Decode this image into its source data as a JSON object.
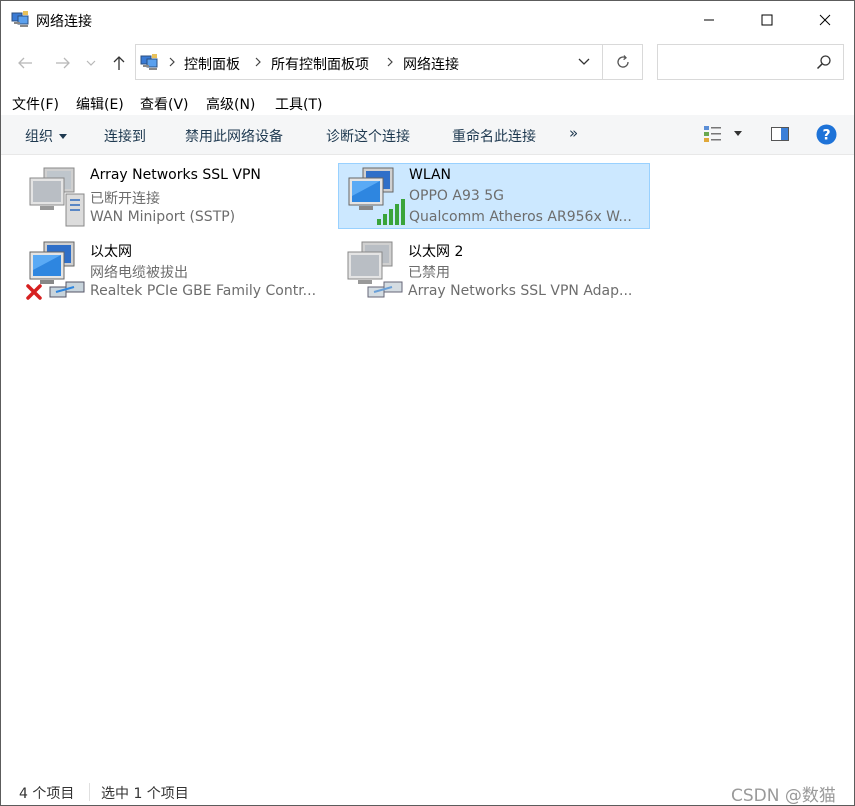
{
  "window": {
    "title": "网络连接",
    "minimize_glyph": "—",
    "maximize_glyph": "☐",
    "close_glyph": "✕"
  },
  "address": {
    "crumbs": [
      "控制面板",
      "所有控制面板项",
      "网络连接"
    ]
  },
  "search": {
    "placeholder": "",
    "value": ""
  },
  "menu": [
    "文件(F)",
    "编辑(E)",
    "查看(V)",
    "高级(N)",
    "工具(T)"
  ],
  "toolbar": {
    "organize": "组织",
    "connect_to": "连接到",
    "disable_device": "禁用此网络设备",
    "diagnose": "诊断这个连接",
    "rename": "重命名此连接",
    "more": "»"
  },
  "connections": [
    {
      "name": "Array Networks SSL VPN",
      "status": "已断开连接",
      "device": "WAN Miniport (SSTP)",
      "type": "vpn",
      "selected": false
    },
    {
      "name": "WLAN",
      "status": "OPPO A93 5G",
      "device": "Qualcomm Atheros AR956x W...",
      "type": "wifi",
      "selected": true
    },
    {
      "name": "以太网",
      "status": "网络电缆被拔出",
      "device": "Realtek PCIe GBE Family Contr...",
      "type": "ethernet-unplugged",
      "selected": false
    },
    {
      "name": "以太网 2",
      "status": "已禁用",
      "device": "Array Networks SSL VPN Adap...",
      "type": "ethernet-disabled",
      "selected": false
    }
  ],
  "statusbar": {
    "count": "4 个项目",
    "selection": "选中 1 个项目",
    "watermark": "CSDN @数猫"
  },
  "colors": {
    "selected_bg": "#cce8ff",
    "selected_border": "#99d1ff",
    "toolbar_bg": "#f5f6f7",
    "help_blue": "#1e73d8"
  }
}
